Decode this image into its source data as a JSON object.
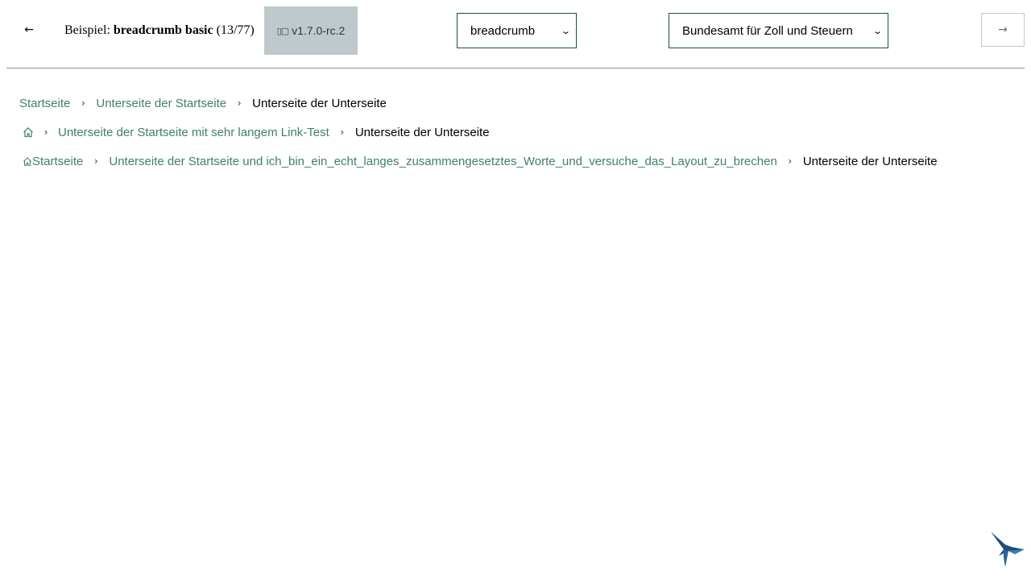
{
  "toolbar": {
    "prev_icon": "arrow-left-icon",
    "prev_glyph": "←",
    "next_icon": "arrow-right-icon",
    "next_glyph": "→",
    "example_prefix": "Beispiel:",
    "example_name": "breadcrumb basic",
    "example_counter": "(13/77)",
    "version_icon": "tablet-icon",
    "version_icon_glyph": "▯▢",
    "version": "v1.7.0-rc.2",
    "component_select": {
      "selected": "breadcrumb",
      "chevron": "⌄"
    },
    "theme_select": {
      "selected": "Bundesamt für Zoll und Steuern",
      "chevron": "⌄"
    }
  },
  "breadcrumbs": [
    {
      "items": [
        {
          "label": "Startseite",
          "link": true
        },
        {
          "label": "Unterseite der Startseite",
          "link": true
        },
        {
          "label": "Unterseite der Unterseite",
          "link": false
        }
      ]
    },
    {
      "home_icon": "home-icon",
      "items": [
        {
          "label": "Unterseite der Startseite mit sehr langem Link-Test",
          "link": true
        },
        {
          "label": "Unterseite der Unterseite",
          "link": false
        }
      ]
    },
    {
      "home_icon": "home-icon",
      "items": [
        {
          "label": "Startseite",
          "link": true
        },
        {
          "label": "Unterseite der Startseite und ich_bin_ein_echt_langes_zusammengesetztes_Worte_und_versuche_das_Layout_zu_brechen",
          "link": true
        },
        {
          "label": "Unterseite der Unterseite",
          "link": false
        }
      ]
    }
  ],
  "separator_glyph": "›",
  "logo_icon": "hummingbird-logo-icon",
  "colors": {
    "link": "#3f7f6c",
    "select_border": "#15524d",
    "badge_bg": "#bfc9cc",
    "logo": "#1f4e79"
  }
}
